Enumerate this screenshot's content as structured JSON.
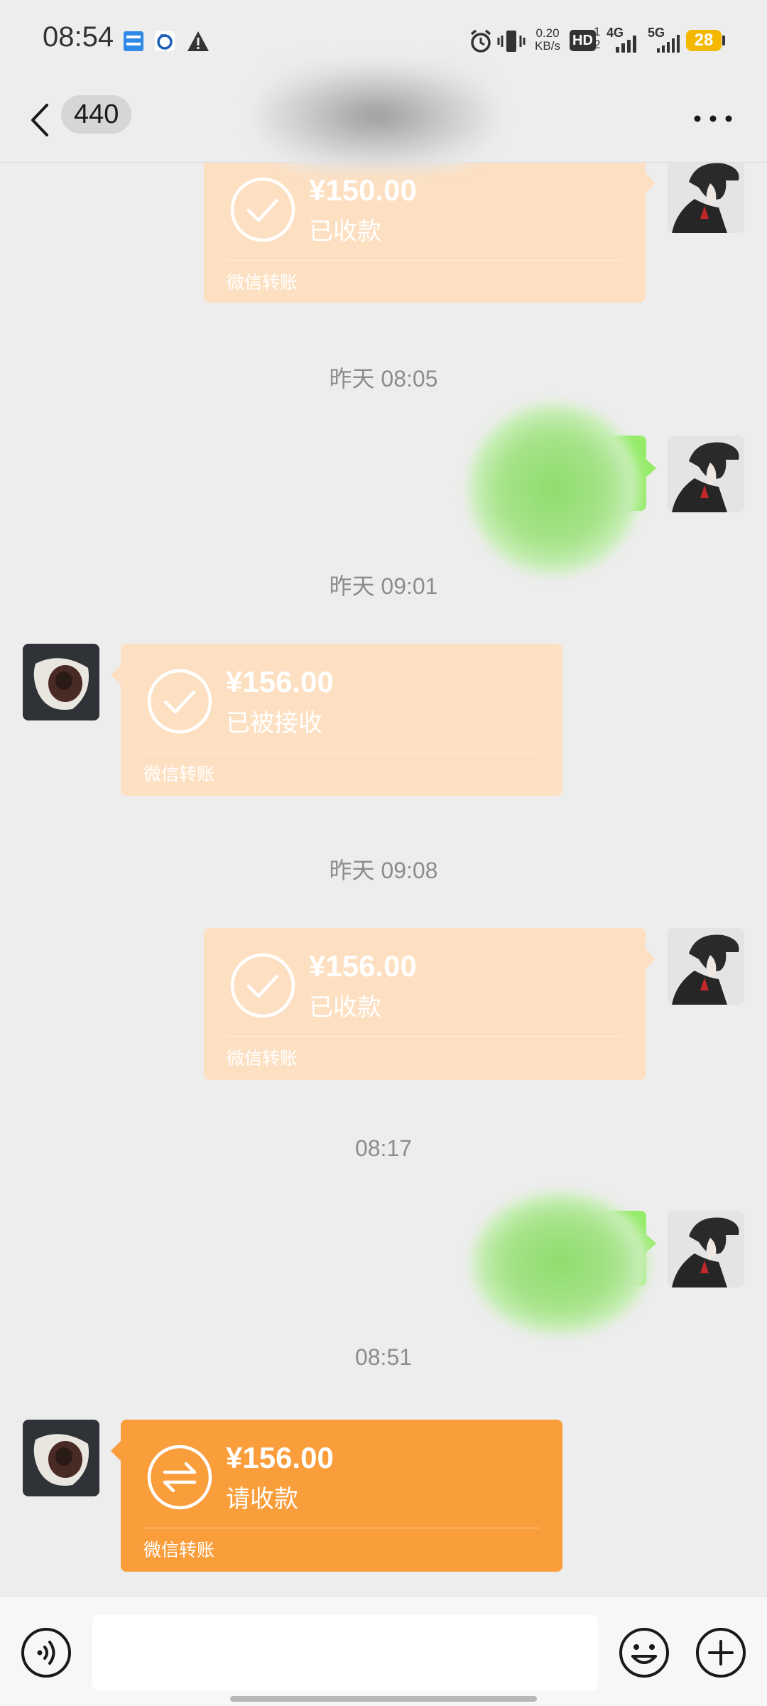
{
  "status_bar": {
    "time": "08:54",
    "notification_icons": [
      "app-badge-icon",
      "sync-app-icon",
      "warning-icon"
    ],
    "system_icons": [
      "alarm-icon",
      "vibrate-icon",
      "hd-icon",
      "signal-4g-icon",
      "signal-5g-icon"
    ],
    "net_speed_value": "0.20",
    "net_speed_unit": "KB/s",
    "hd_label": "HD",
    "net_4g": "4G",
    "net_5g": "5G",
    "battery": "28",
    "battery_color": "#f5b800"
  },
  "nav": {
    "back_icon": "chevron-left-icon",
    "unread_count": "440",
    "more_icon": "more-horizontal-icon"
  },
  "messages": [
    {
      "type": "transfer",
      "side": "right",
      "amount": "¥150.00",
      "status": "已收款",
      "label": "微信转账",
      "icon": "check-circle-icon"
    },
    {
      "type": "timestamp",
      "text": "昨天 08:05"
    },
    {
      "type": "text",
      "side": "right",
      "content_obscured": true
    },
    {
      "type": "timestamp",
      "text": "昨天 09:01"
    },
    {
      "type": "transfer",
      "side": "left",
      "amount": "¥156.00",
      "status": "已被接收",
      "label": "微信转账",
      "icon": "check-circle-icon"
    },
    {
      "type": "timestamp",
      "text": "昨天 09:08"
    },
    {
      "type": "transfer",
      "side": "right",
      "amount": "¥156.00",
      "status": "已收款",
      "label": "微信转账",
      "icon": "check-circle-icon"
    },
    {
      "type": "timestamp",
      "text": "08:17"
    },
    {
      "type": "text",
      "side": "right",
      "content_obscured": true
    },
    {
      "type": "timestamp",
      "text": "08:51"
    },
    {
      "type": "transfer",
      "side": "left",
      "amount": "¥156.00",
      "status": "请收款",
      "label": "微信转账",
      "icon": "transfer-arrows-icon",
      "highlight": true
    }
  ],
  "input_bar": {
    "voice_icon": "voice-icon",
    "input_value": "",
    "emoji_icon": "emoji-icon",
    "plus_icon": "plus-circle-icon"
  },
  "colors": {
    "background": "#ededed",
    "transfer_received": "#fde0c2",
    "transfer_pending": "#fa9d3b",
    "bubble_self": "#95ec69"
  }
}
